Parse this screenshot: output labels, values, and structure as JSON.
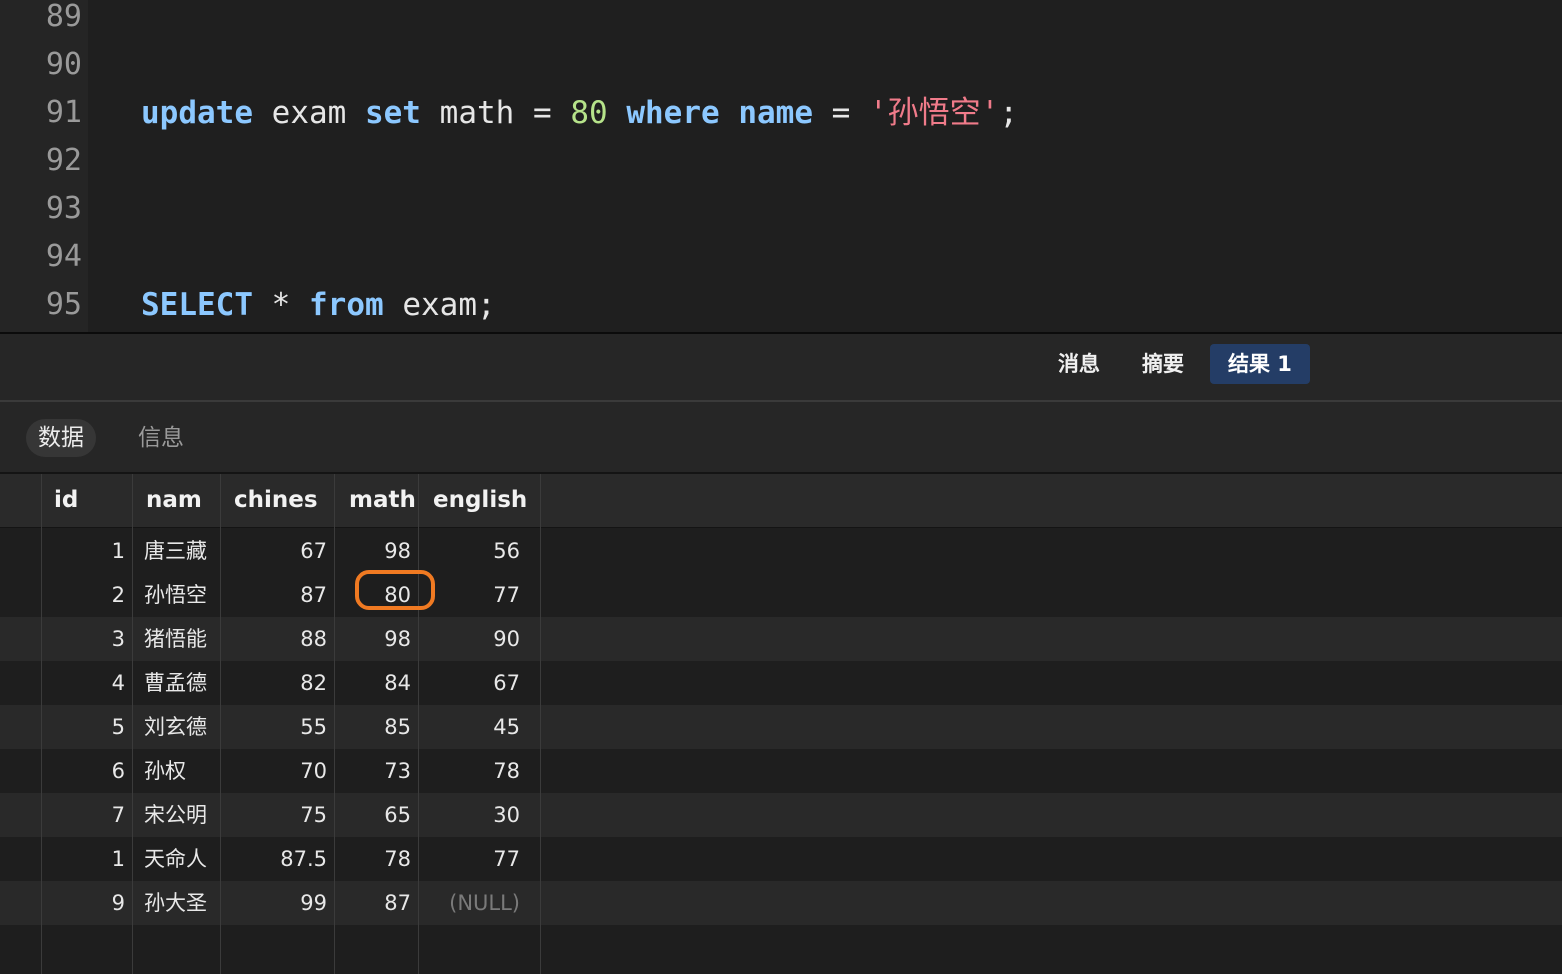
{
  "editor": {
    "lines": [
      {
        "no": "89"
      },
      {
        "no": "90"
      },
      {
        "no": "91",
        "tokens": [
          "update",
          "exam",
          "set",
          "math",
          "=",
          "80",
          "where",
          "name",
          "=",
          "'孙悟空'",
          ";"
        ]
      },
      {
        "no": "92"
      },
      {
        "no": "93"
      },
      {
        "no": "94"
      },
      {
        "no": "95",
        "tokens": [
          "SELECT",
          "*",
          "from",
          "exam",
          ";"
        ]
      }
    ]
  },
  "result_tabs": [
    "消息",
    "摘要",
    "结果 1"
  ],
  "active_result_tab": "结果 1",
  "sub_tabs": [
    "数据",
    "信息"
  ],
  "active_sub_tab": "数据",
  "table": {
    "columns": [
      "id",
      "nam",
      "chines",
      "math",
      "english"
    ],
    "rows": [
      [
        "1",
        "唐三藏",
        "67",
        "98",
        "56"
      ],
      [
        "2",
        "孙悟空",
        "87",
        "80",
        "77"
      ],
      [
        "3",
        "猪悟能",
        "88",
        "98",
        "90"
      ],
      [
        "4",
        "曹孟德",
        "82",
        "84",
        "67"
      ],
      [
        "5",
        "刘玄德",
        "55",
        "85",
        "45"
      ],
      [
        "6",
        "孙权",
        "70",
        "73",
        "78"
      ],
      [
        "7",
        "宋公明",
        "75",
        "65",
        "30"
      ],
      [
        "1",
        "天命人",
        "87.5",
        "78",
        "77"
      ],
      [
        "9",
        "孙大圣",
        "99",
        "87",
        "(NULL)"
      ]
    ],
    "highlighted_cell": {
      "row": 1,
      "column": "math"
    }
  },
  "colors": {
    "keyword": "#8cc8ff",
    "number": "#b6e38a",
    "string": "#f07b8a",
    "active_tab": "#243d66",
    "highlight_ring": "#f07a22"
  }
}
